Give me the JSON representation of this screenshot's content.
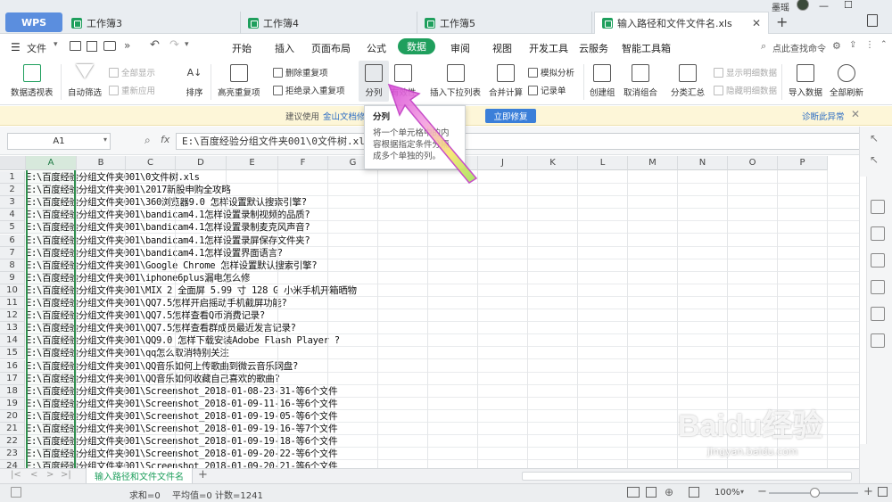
{
  "app": {
    "logo": "WPS"
  },
  "tabs": [
    {
      "label": "工作簿3"
    },
    {
      "label": "工作簿4"
    },
    {
      "label": "工作簿5"
    },
    {
      "label": "输入路径和文件文件名.xls"
    }
  ],
  "user": {
    "name": "墨瑶"
  },
  "menubar": {
    "file_label": "文件",
    "items": [
      "开始",
      "插入",
      "页面布局",
      "公式",
      "数据",
      "审阅",
      "视图",
      "开发工具",
      "云服务",
      "智能工具箱"
    ],
    "active": "数据",
    "search_placeholder": "点此查找命令"
  },
  "ribbon": {
    "pivot": "数据透视表",
    "autofilter": "自动筛选",
    "show_all": "全部显示",
    "reapply": "重新应用",
    "sort": "排序",
    "highlight_dup": "高亮重复项",
    "remove_dup": "删除重复项",
    "reject_dup": "拒绝录入重复项",
    "split": "分列",
    "validity": "有效性",
    "insert_dropdown": "插入下拉列表",
    "consolidate": "合并计算",
    "whatif": "模拟分析",
    "record": "记录单",
    "create_group": "创建组",
    "ungroup": "取消组合",
    "subtotal": "分类汇总",
    "show_detail": "显示明细数据",
    "hide_detail": "隐藏明细数据",
    "import": "导入数据",
    "refresh_all": "全部刷新"
  },
  "notice": {
    "text_pre": "建议使用",
    "link": "金山文档修",
    "button": "立即修复",
    "right_link": "诊断此异常"
  },
  "tooltip": {
    "title": "分列",
    "body": "将一个单元格中的内容根据指定条件分隔成多个单独的列。"
  },
  "formula_bar": {
    "name_box": "A1",
    "fx": "fx",
    "value": "E:\\百度经验分组文件夹001\\0文件树.xls"
  },
  "columns": [
    "A",
    "B",
    "C",
    "D",
    "E",
    "F",
    "G",
    "H",
    "I",
    "J",
    "K",
    "L",
    "M",
    "N",
    "O",
    "P"
  ],
  "rows": [
    {
      "n": "1",
      "v": "E:\\百度经验分组文件夹001\\0文件树.xls"
    },
    {
      "n": "2",
      "v": "E:\\百度经验分组文件夹001\\2017新股申购全攻略"
    },
    {
      "n": "3",
      "v": "E:\\百度经验分组文件夹001\\360浏览器9.0 怎样设置默认搜索引擎?"
    },
    {
      "n": "4",
      "v": "E:\\百度经验分组文件夹001\\bandicam4.1怎样设置录制视频的品质?"
    },
    {
      "n": "5",
      "v": "E:\\百度经验分组文件夹001\\bandicam4.1怎样设置录制麦克风声音?"
    },
    {
      "n": "6",
      "v": "E:\\百度经验分组文件夹001\\bandicam4.1怎样设置录屏保存文件夹?"
    },
    {
      "n": "7",
      "v": "E:\\百度经验分组文件夹001\\bandicam4.1怎样设置界面语言?"
    },
    {
      "n": "8",
      "v": "E:\\百度经验分组文件夹001\\Google Chrome 怎样设置默认搜索引擎?"
    },
    {
      "n": "9",
      "v": "E:\\百度经验分组文件夹001\\iphone6plus漏电怎么修"
    },
    {
      "n": "10",
      "v": "E:\\百度经验分组文件夹001\\MIX 2 全面屏 5.99 寸 128 G 小米手机开箱晒物"
    },
    {
      "n": "11",
      "v": "E:\\百度经验分组文件夹001\\QQ7.5怎样开启摇动手机截屏功能?"
    },
    {
      "n": "12",
      "v": "E:\\百度经验分组文件夹001\\QQ7.5怎样查看Q币消费记录?"
    },
    {
      "n": "13",
      "v": "E:\\百度经验分组文件夹001\\QQ7.5怎样查看群成员最近发言记录?"
    },
    {
      "n": "14",
      "v": "E:\\百度经验分组文件夹001\\QQ9.0 怎样下载安装Adobe Flash Player ?"
    },
    {
      "n": "15",
      "v": "E:\\百度经验分组文件夹001\\qq怎么取消特别关注"
    },
    {
      "n": "16",
      "v": "E:\\百度经验分组文件夹001\\QQ音乐如何上传歌曲到微云音乐网盘?"
    },
    {
      "n": "17",
      "v": "E:\\百度经验分组文件夹001\\QQ音乐如何收藏自己喜欢的歌曲?"
    },
    {
      "n": "18",
      "v": "E:\\百度经验分组文件夹001\\Screenshot_2018-01-08-23-31-等6个文件"
    },
    {
      "n": "19",
      "v": "E:\\百度经验分组文件夹001\\Screenshot_2018-01-09-11-16-等6个文件"
    },
    {
      "n": "20",
      "v": "E:\\百度经验分组文件夹001\\Screenshot_2018-01-09-19-05-等6个文件"
    },
    {
      "n": "21",
      "v": "E:\\百度经验分组文件夹001\\Screenshot_2018-01-09-19-16-等7个文件"
    },
    {
      "n": "22",
      "v": "E:\\百度经验分组文件夹001\\Screenshot_2018-01-09-19-18-等6个文件"
    },
    {
      "n": "23",
      "v": "E:\\百度经验分组文件夹001\\Screenshot_2018-01-09-20-22-等6个文件"
    },
    {
      "n": "24",
      "v": "E:\\百度经验分组文件夹001\\Screenshot_2018-01-09-20-21-等6个文件"
    }
  ],
  "sheet_tab": "输入路径和文件文件名",
  "status": {
    "sum": "求和=0",
    "avg": "平均值=0",
    "count": "计数=1241",
    "zoom": "100%"
  },
  "watermark": {
    "text": "Baidu经验",
    "url": "jingyan.baidu.com"
  },
  "colors": {
    "accent": "#1f9f5d",
    "tab_active_menu": "#1f9f5d",
    "select_border": "#2f8f4e"
  }
}
